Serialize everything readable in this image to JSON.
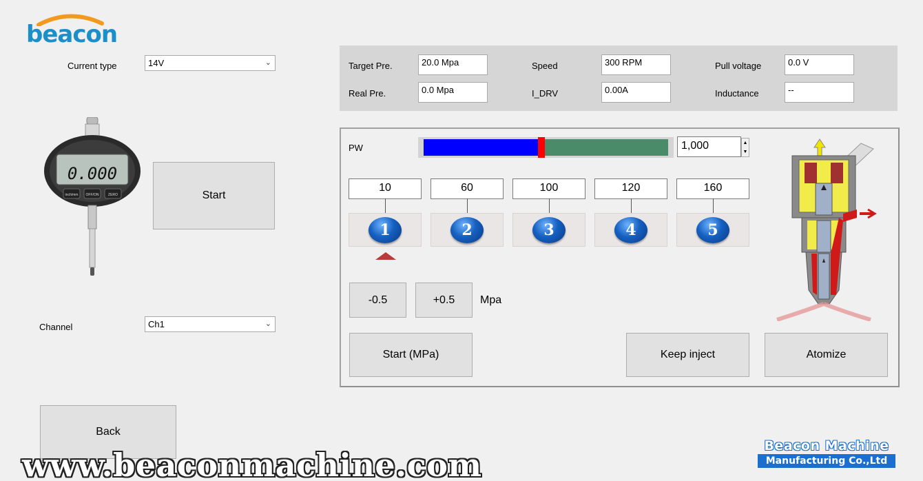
{
  "brand": {
    "logo_text": "beacon"
  },
  "left": {
    "current_type_label": "Current type",
    "current_type_value": "14V",
    "start_label": "Start",
    "channel_label": "Channel",
    "channel_value": "Ch1",
    "back_label": "Back"
  },
  "gauge": {
    "reading": "0.000",
    "btn_inch": "inch/mm",
    "btn_off": "OFF/ON",
    "btn_zero": "ZERO"
  },
  "info": {
    "target_pre_label": "Target Pre.",
    "target_pre_value": "20.0 Mpa",
    "real_pre_label": "Real Pre.",
    "real_pre_value": "0.0 Mpa",
    "speed_label": "Speed",
    "speed_value": "300 RPM",
    "idrv_label": "I_DRV",
    "idrv_value": "0.00A",
    "pull_voltage_label": "Pull voltage",
    "pull_voltage_value": "0.0 V",
    "inductance_label": "Inductance",
    "inductance_value": "--"
  },
  "pw": {
    "label": "PW",
    "value": "1,000",
    "level_fraction": 0.48
  },
  "presets": [
    {
      "value": "10",
      "number": "1"
    },
    {
      "value": "60",
      "number": "2"
    },
    {
      "value": "100",
      "number": "3"
    },
    {
      "value": "120",
      "number": "4"
    },
    {
      "value": "160",
      "number": "5"
    }
  ],
  "pressure": {
    "minus_label": "-0.5",
    "plus_label": "+0.5",
    "unit": "Mpa"
  },
  "actions": {
    "start_mpa_label": "Start (MPa)",
    "keep_inject_label": "Keep inject",
    "atomize_label": "Atomize"
  },
  "footer": {
    "watermark": "www.beaconmachine.com",
    "company_line1": "Beacon Machine",
    "company_line2": "Manufacturing Co.,Ltd"
  },
  "colors": {
    "pw_fill": "#0000ff",
    "pw_rest": "#4a8c6a",
    "pw_thumb": "#ff0000",
    "accent": "#1c8fc9"
  }
}
